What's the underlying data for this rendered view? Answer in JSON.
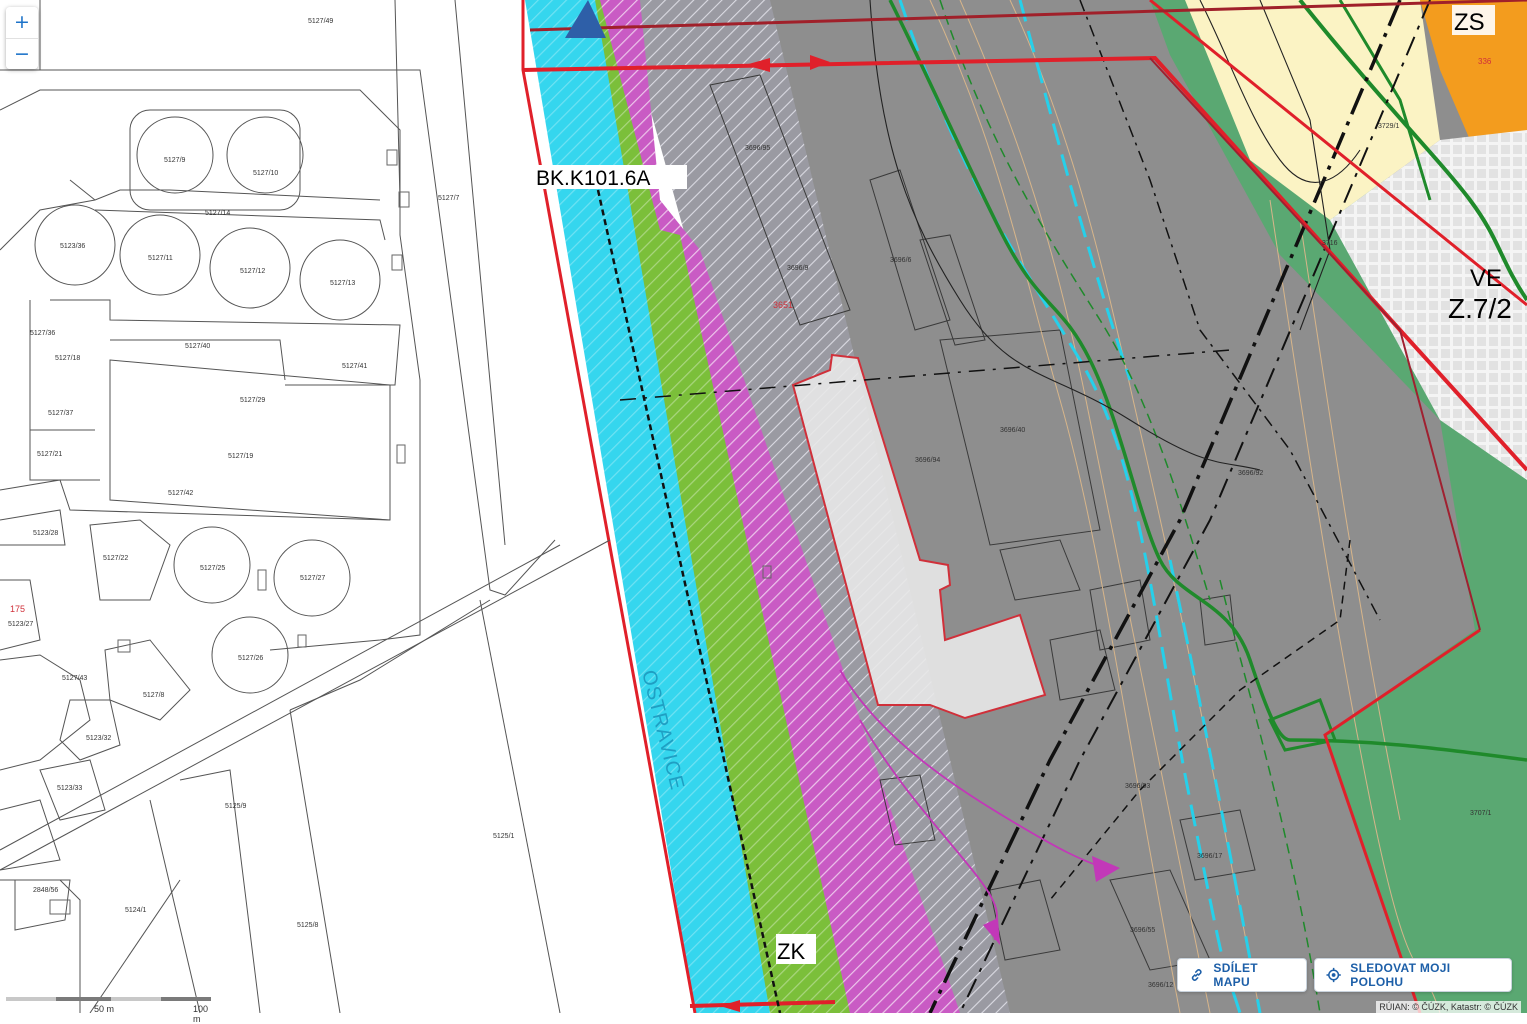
{
  "map": {
    "zoom_in_label": "+",
    "zoom_out_label": "−",
    "zone_labels": {
      "bk": "BK.K101.6A",
      "zs": "ZS",
      "ve": "VE",
      "z72": "Z.7/2",
      "zk": "ZK",
      "river": "OSTRAVICE"
    },
    "parcels": [
      "5127/49",
      "5127/9",
      "5127/10",
      "5127/14",
      "5127/7",
      "5123/36",
      "5127/11",
      "5127/12",
      "5127/13",
      "5127/36",
      "5127/40",
      "5127/41",
      "5127/18",
      "5127/37",
      "5127/29",
      "5127/19",
      "5127/21",
      "5127/42",
      "5123/28",
      "5127/22",
      "5127/25",
      "5127/27",
      "175",
      "5123/27",
      "5127/26",
      "5127/43",
      "5127/8",
      "5123/32",
      "5123/33",
      "5125/9",
      "5125/1",
      "2848/56",
      "5124/1",
      "5125/8",
      "3696/95",
      "3696/6",
      "3696/9",
      "3651",
      "3696/94",
      "3696/40",
      "3696/92",
      "3696/93",
      "3696/55",
      "3696/17",
      "3707/1",
      "3729/1",
      "336",
      "3716",
      "3696/12"
    ],
    "colors": {
      "cadastral_line": "#555555",
      "river_blue": "#35d6ee",
      "green_zone": "#7bbf3a",
      "magenta_zone": "#c95bc4",
      "gray_zone": "#8e8e8e",
      "dark_green_zone": "#5aa872",
      "light_yellow_zone": "#fbf3c4",
      "orange_zone": "#f39c1e",
      "red_line": "#e0202a",
      "accent": "#1d5fa8"
    }
  },
  "buttons": {
    "share_label": "SDÍLET MAPU",
    "share_icon": "link-icon",
    "locate_label": "SLEDOVAT MOJI POLOHU",
    "locate_icon": "crosshair-icon"
  },
  "scale": {
    "label_50": "50 m",
    "label_100": "100 m"
  },
  "attribution": "RÚIAN: © ČÚZK, Katastr: © ČÚZK"
}
